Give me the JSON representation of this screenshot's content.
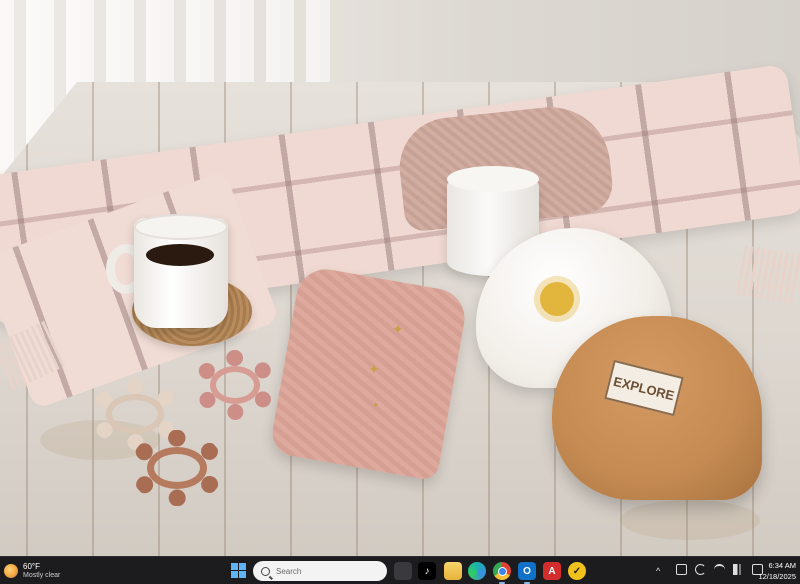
{
  "wallpaper": {
    "patch_text": "EXPLORE",
    "palette": {
      "wood": "#dcd6cf",
      "scarf": "#efd9d2",
      "mitten": "#d69f93",
      "tan_cap": "#c48a52",
      "sun": "#e2b53c"
    }
  },
  "taskbar": {
    "weather": {
      "temp": "60°F",
      "desc": "Mostly clear",
      "icon": "moon-cloud-icon"
    },
    "search": {
      "placeholder": "Search"
    },
    "apps": [
      {
        "name": "task-view",
        "glyph": ""
      },
      {
        "name": "tiktok",
        "glyph": "♪"
      },
      {
        "name": "file-explorer",
        "glyph": ""
      },
      {
        "name": "edge",
        "glyph": ""
      },
      {
        "name": "chrome",
        "glyph": ""
      },
      {
        "name": "outlook",
        "glyph": "O"
      },
      {
        "name": "acrobat",
        "glyph": "A"
      },
      {
        "name": "norton",
        "glyph": "✓"
      }
    ],
    "tray": {
      "chevron": "^"
    },
    "clock": {
      "time": "6:34 AM",
      "date": "12/18/2025"
    },
    "colors": {
      "bg": "#1c1c1f",
      "accent": "#5fb4f5"
    }
  }
}
